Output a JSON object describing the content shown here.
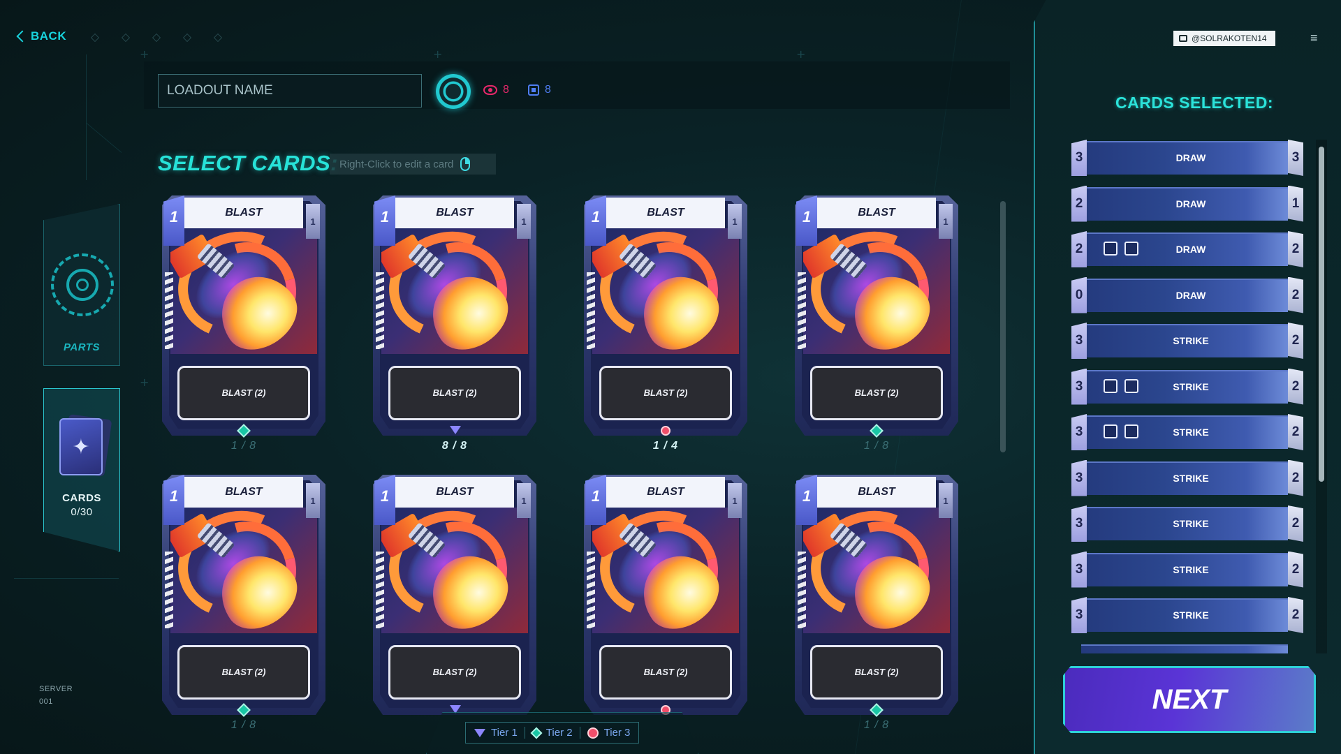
{
  "header": {
    "back_label": "BACK"
  },
  "nav": {
    "parts_label": "PARTS",
    "cards_label": "CARDS",
    "cards_count": "0/30",
    "server_label": "SERVER",
    "server_id": "001"
  },
  "loadout": {
    "placeholder": "LOADOUT NAME",
    "stat_eye": "8",
    "stat_chip": "8"
  },
  "select": {
    "heading": "SELECT CARDS:",
    "hint": "Right-Click to edit a card"
  },
  "cards": [
    {
      "title": "BLAST",
      "cost": "1",
      "cost_right": "1",
      "desc": "BLAST (2)",
      "tier": "tier-2",
      "count": "1 / 8"
    },
    {
      "title": "BLAST",
      "cost": "1",
      "cost_right": "1",
      "desc": "BLAST (2)",
      "tier": "tier-1",
      "count": "8 / 8"
    },
    {
      "title": "BLAST",
      "cost": "1",
      "cost_right": "1",
      "desc": "BLAST (2)",
      "tier": "tier-3",
      "count": "1 / 4"
    },
    {
      "title": "BLAST",
      "cost": "1",
      "cost_right": "1",
      "desc": "BLAST (2)",
      "tier": "tier-2",
      "count": "1 / 8"
    },
    {
      "title": "BLAST",
      "cost": "1",
      "cost_right": "1",
      "desc": "BLAST (2)",
      "tier": "tier-2",
      "count": "1 / 8"
    },
    {
      "title": "BLAST",
      "cost": "1",
      "cost_right": "1",
      "desc": "BLAST (2)",
      "tier": "tier-1",
      "count": ""
    },
    {
      "title": "BLAST",
      "cost": "1",
      "cost_right": "1",
      "desc": "BLAST (2)",
      "tier": "tier-3",
      "count": ""
    },
    {
      "title": "BLAST",
      "cost": "1",
      "cost_right": "1",
      "desc": "BLAST (2)",
      "tier": "tier-2",
      "count": "1 / 8"
    }
  ],
  "legend": {
    "tier1": "Tier 1",
    "tier2": "Tier 2",
    "tier3": "Tier 3"
  },
  "right_panel": {
    "user": "@SOLRAKOTEN14",
    "heading": "CARDS SELECTED:",
    "next_label": "NEXT",
    "rows": [
      {
        "cost": "3",
        "name": "DRAW",
        "qty": "3",
        "icons": false
      },
      {
        "cost": "2",
        "name": "DRAW",
        "qty": "1",
        "icons": false
      },
      {
        "cost": "2",
        "name": "DRAW",
        "qty": "2",
        "icons": true
      },
      {
        "cost": "0",
        "name": "DRAW",
        "qty": "2",
        "icons": false
      },
      {
        "cost": "3",
        "name": "STRIKE",
        "qty": "2",
        "icons": false
      },
      {
        "cost": "3",
        "name": "STRIKE",
        "qty": "2",
        "icons": true
      },
      {
        "cost": "3",
        "name": "STRIKE",
        "qty": "2",
        "icons": true
      },
      {
        "cost": "3",
        "name": "STRIKE",
        "qty": "2",
        "icons": false
      },
      {
        "cost": "3",
        "name": "STRIKE",
        "qty": "2",
        "icons": false
      },
      {
        "cost": "3",
        "name": "STRIKE",
        "qty": "2",
        "icons": false
      },
      {
        "cost": "3",
        "name": "STRIKE",
        "qty": "2",
        "icons": false
      }
    ]
  },
  "colors": {
    "accent": "#27e2d8",
    "tier1": "#8c86ff",
    "tier2": "#19c6a5",
    "tier3": "#f04e6a"
  }
}
